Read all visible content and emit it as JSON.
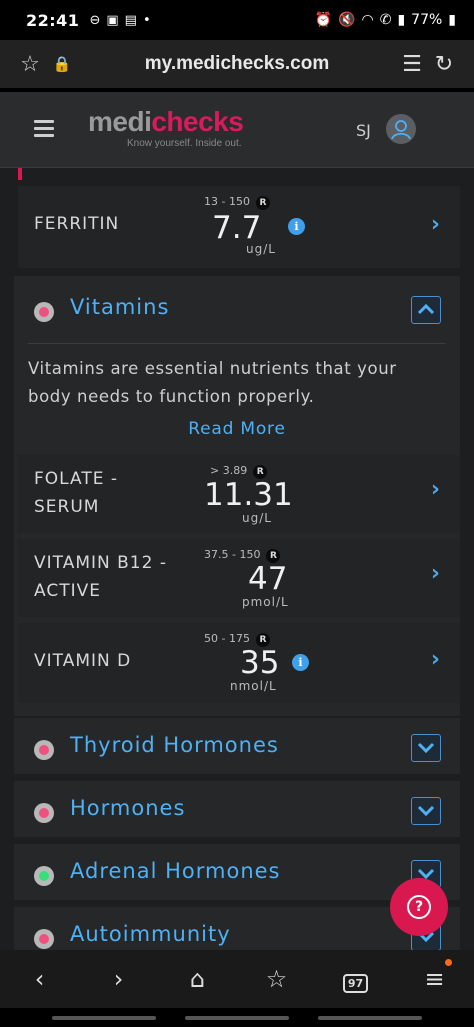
{
  "status": {
    "time": "22:41",
    "battery": "77%"
  },
  "browser": {
    "url": "my.medichecks.com",
    "tab_count": "97"
  },
  "header": {
    "logo_part1": "medi",
    "logo_part2": "checks",
    "tagline": "Know yourself. Inside out.",
    "initials": "SJ"
  },
  "results": {
    "ferritin": {
      "name": "FERRITIN",
      "range": "13 - 150",
      "range_badge": "R",
      "value": "7.7",
      "unit": "ug/L"
    }
  },
  "vitamins": {
    "title": "Vitamins",
    "description": "Vitamins are essential nutrients that your body needs to function properly.",
    "read_more": "Read More",
    "tests": [
      {
        "name_line1": "FOLATE -",
        "name_line2": "SERUM",
        "range": "> 3.89",
        "range_badge": "R",
        "value": "11.31",
        "unit": "ug/L",
        "status_color": "#2db34a"
      },
      {
        "name_line1": "VITAMIN B12 -",
        "name_line2": "ACTIVE",
        "range": "37.5 - 150",
        "range_badge": "R",
        "value": "47",
        "unit": "pmol/L",
        "status_color": "#2db34a"
      },
      {
        "name_line1": "VITAMIN D",
        "name_line2": "",
        "range": "50 - 175",
        "range_badge": "R",
        "value": "35",
        "unit": "nmol/L",
        "status_color": "#d8184f"
      }
    ]
  },
  "sections": [
    {
      "title": "Thyroid Hormones",
      "dot_color": "#f0507e"
    },
    {
      "title": "Hormones",
      "dot_color": "#f0507e"
    },
    {
      "title": "Adrenal Hormones",
      "dot_color": "#36e07a"
    },
    {
      "title": "Autoimmunity",
      "dot_color": "#f0507e"
    }
  ],
  "colors": {
    "accent_blue": "#4fb1f5",
    "brand_pink": "#d8184f",
    "status_red": "#d8184f",
    "status_green": "#2db34a"
  }
}
